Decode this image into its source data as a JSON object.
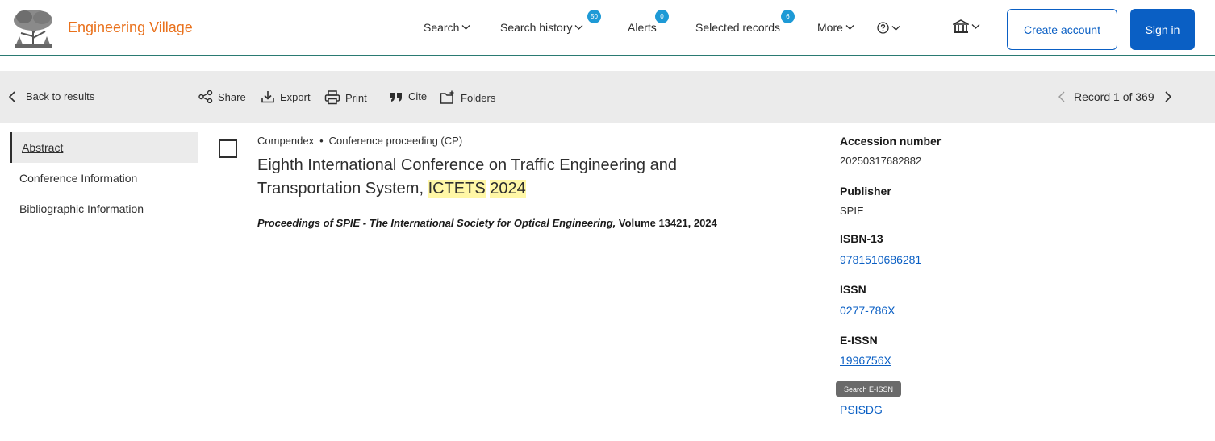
{
  "header": {
    "brand": "Engineering Village",
    "nav": {
      "search": "Search",
      "search_history": "Search history",
      "search_history_count": "50",
      "alerts": "Alerts",
      "alerts_count": "0",
      "selected_records": "Selected records",
      "selected_records_count": "6",
      "more": "More"
    },
    "create_account": "Create account",
    "sign_in": "Sign in",
    "icons": [
      "help-icon",
      "institution-icon",
      "chevron-down-icon"
    ]
  },
  "toolbar": {
    "back": "Back to results",
    "share": "Share",
    "export": "Export",
    "print": "Print",
    "cite": "Cite",
    "folders": "Folders",
    "record_nav": "Record 1 of 369"
  },
  "sidebar": {
    "items": [
      {
        "label": "Abstract",
        "active": true
      },
      {
        "label": "Conference Information",
        "active": false
      },
      {
        "label": "Bibliographic Information",
        "active": false
      }
    ]
  },
  "record": {
    "database": "Compendex",
    "doc_type": "Conference proceeding (CP)",
    "title_part1": "Eighth International Conference on Traffic Engineering and Transportation System, ",
    "title_hl1": "ICTETS",
    "title_hl2": "2024",
    "source_title": "Proceedings of SPIE - The International Society for Optical Engineering,",
    "source_volume": "Volume 13421, 2024"
  },
  "details": {
    "accession_label": "Accession number",
    "accession_value": "20250317682882",
    "publisher_label": "Publisher",
    "publisher_value": "SPIE",
    "isbn_label": "ISBN-13",
    "isbn_value": "9781510686281",
    "issn_label": "ISSN",
    "issn_value": "0277-786X",
    "eissn_label": "E-ISSN",
    "eissn_value": "1996756X",
    "tooltip": "Search E-ISSN",
    "coden_value": "PSISDG"
  },
  "colors": {
    "brand": "#e9711c",
    "primary": "#0a5fc4",
    "badge": "#1e9ad6",
    "highlight": "#fff7a6",
    "toolbar_bg": "#ebebeb"
  }
}
